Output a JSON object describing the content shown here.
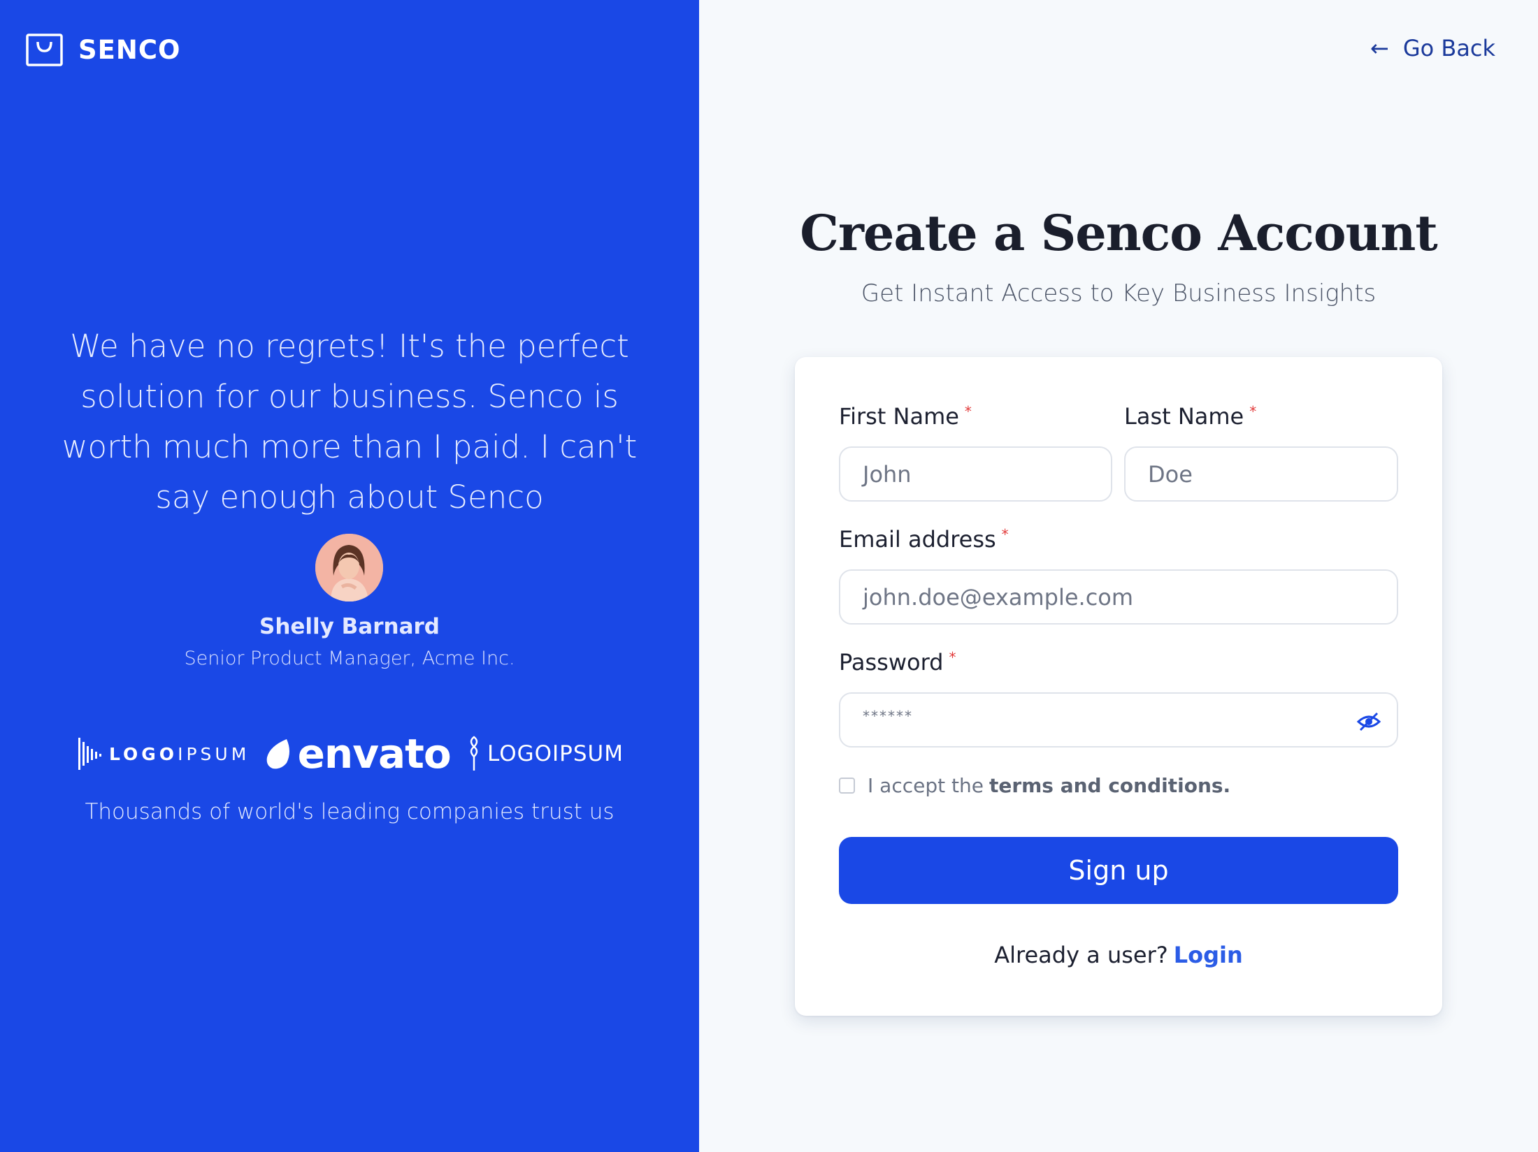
{
  "brand": {
    "name": "SENCO"
  },
  "testimonial": {
    "quote": "We have no regrets! It's the perfect solution for our business. Senco is worth much more than I paid. I can't say enough about Senco",
    "name": "Shelly Barnard",
    "role": "Senior Product Manager, Acme Inc."
  },
  "logos": {
    "logo1_bold": "LOGO",
    "logo1_light": "IPSUM",
    "logo2": "envato",
    "logo3": "LOGOIPSUM"
  },
  "trust_text": "Thousands of world's leading companies trust us",
  "nav": {
    "go_back": "Go Back",
    "go_back_icon": "arrow-left-icon"
  },
  "header": {
    "title": "Create a Senco Account",
    "subtitle": "Get Instant Access to Key Business Insights"
  },
  "form": {
    "first_name_label": "First Name",
    "first_name_placeholder": "John",
    "last_name_label": "Last Name",
    "last_name_placeholder": "Doe",
    "email_label": "Email address",
    "email_placeholder": "john.doe@example.com",
    "password_label": "Password",
    "password_value": "******",
    "required_mark": "*",
    "accept_prefix": "I accept the",
    "terms_link": "terms and conditions.",
    "submit_label": "Sign up",
    "already_text": "Already a user?",
    "login_link": "Login"
  },
  "colors": {
    "accent": "#1a48e6",
    "required": "#e23b3b",
    "link": "#2b5ce6"
  }
}
